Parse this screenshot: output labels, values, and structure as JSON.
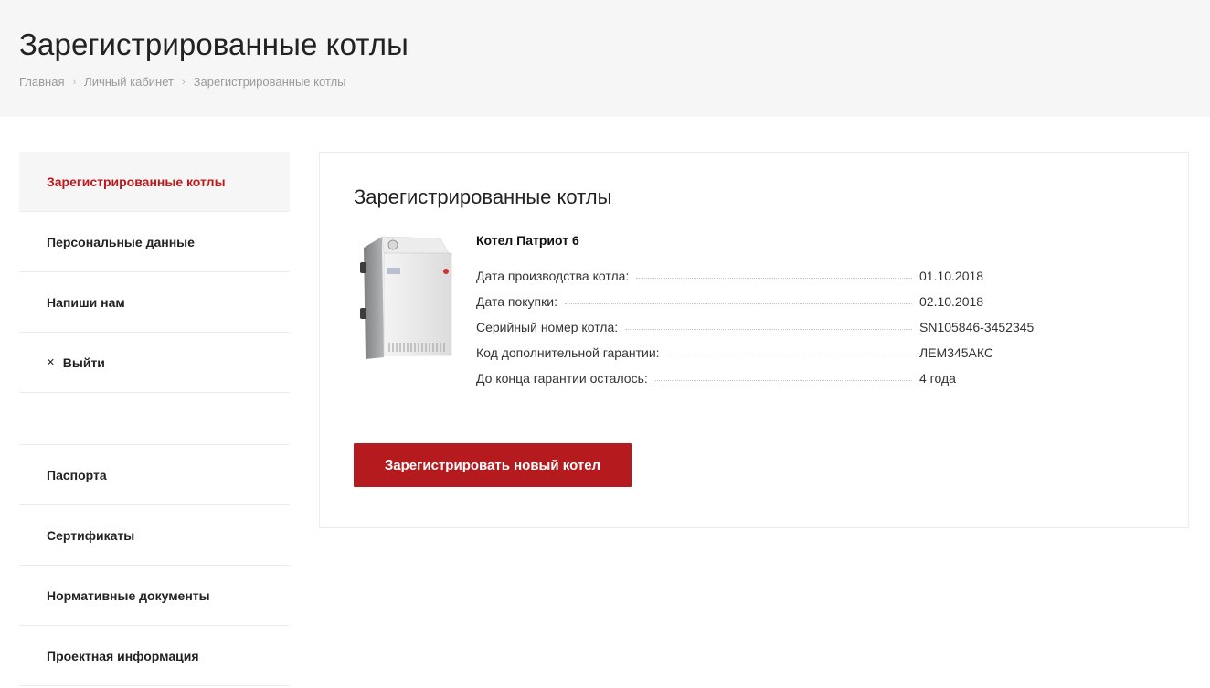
{
  "header": {
    "title": "Зарегистрированные котлы",
    "breadcrumb": [
      "Главная",
      "Личный кабинет",
      "Зарегистрированные котлы"
    ]
  },
  "sidebar": {
    "account_items": [
      {
        "label": "Зарегистрированные котлы",
        "active": true
      },
      {
        "label": "Персональные данные"
      },
      {
        "label": "Напиши нам"
      },
      {
        "label": "Выйти",
        "icon": "close-icon"
      }
    ],
    "doc_items": [
      {
        "label": "Паспорта"
      },
      {
        "label": "Сертификаты"
      },
      {
        "label": "Нормативные документы"
      },
      {
        "label": "Проектная информация"
      }
    ]
  },
  "main": {
    "title": "Зарегистрированные котлы",
    "boiler": {
      "name": "Котел Патриот 6",
      "fields": [
        {
          "label": "Дата производства котла:",
          "value": "01.10.2018"
        },
        {
          "label": "Дата покупки:",
          "value": "02.10.2018"
        },
        {
          "label": "Серийный номер котла:",
          "value": "SN105846-3452345"
        },
        {
          "label": "Код дополнительной гарантии:",
          "value": "ЛЕМ345АКС"
        },
        {
          "label": "До конца гарантии осталось:",
          "value": "4 года"
        }
      ]
    },
    "register_button": "Зарегистрировать новый котел"
  },
  "colors": {
    "accent": "#c0171c",
    "button": "#b51a1f",
    "header_bg": "#f6f6f6"
  }
}
